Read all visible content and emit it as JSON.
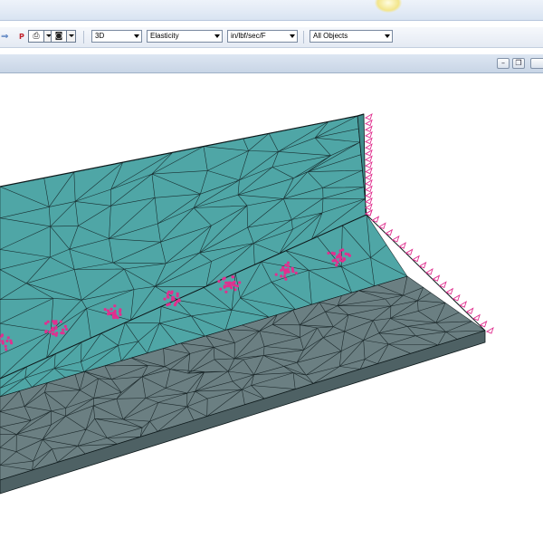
{
  "toolbar": {
    "left_icon": "⇒",
    "p_label": "P",
    "view_mode": "3D",
    "analysis_type": "Elasticity",
    "units": "in/lbf/sec/F",
    "object_filter": "All Objects"
  },
  "icons": [
    "arrow-icon",
    "print-icon",
    "camera-icon",
    "minimize-icon",
    "restore-icon"
  ],
  "colors": {
    "mesh_top_surface": "#4fa6a6",
    "mesh_bottom_surface": "#6b7f82",
    "mesh_lines": "#0e1a1c",
    "constraint_markers": "#e0308f"
  }
}
